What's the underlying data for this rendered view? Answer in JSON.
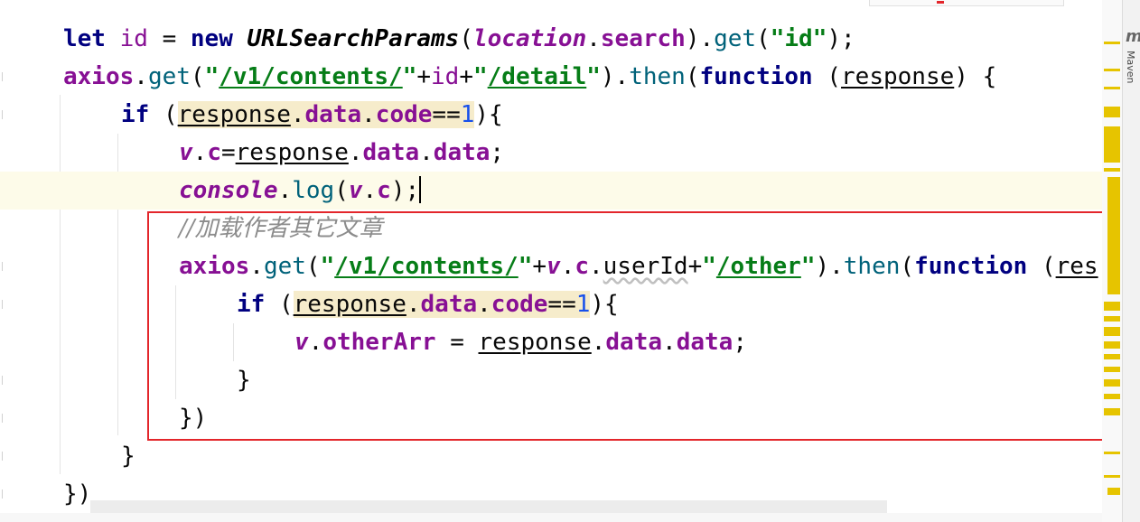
{
  "editor": {
    "lines": [
      {
        "id": 1,
        "tokens": [
          {
            "t": "let",
            "c": "kw"
          },
          {
            "t": " "
          },
          {
            "t": "id",
            "c": "v"
          },
          {
            "t": " = "
          },
          {
            "t": "new",
            "c": "kw"
          },
          {
            "t": " "
          },
          {
            "t": "URLSearchParams",
            "c": "cls"
          },
          {
            "t": "("
          },
          {
            "t": "location",
            "c": "vbi"
          },
          {
            "t": "."
          },
          {
            "t": "search",
            "c": "vb"
          },
          {
            "t": ")."
          },
          {
            "t": "get",
            "c": "fn"
          },
          {
            "t": "("
          },
          {
            "t": "\"id\"",
            "c": "str"
          },
          {
            "t": ");"
          }
        ]
      },
      {
        "id": 2,
        "tokens": [
          {
            "t": "axios",
            "c": "vb"
          },
          {
            "t": "."
          },
          {
            "t": "get",
            "c": "fn"
          },
          {
            "t": "("
          },
          {
            "t": "\"",
            "c": "str"
          },
          {
            "t": "/v1/contents/",
            "c": "str u"
          },
          {
            "t": "\"",
            "c": "str"
          },
          {
            "t": "+"
          },
          {
            "t": "id",
            "c": "v"
          },
          {
            "t": "+"
          },
          {
            "t": "\"",
            "c": "str"
          },
          {
            "t": "/detail",
            "c": "str u"
          },
          {
            "t": "\"",
            "c": "str"
          },
          {
            "t": ")."
          },
          {
            "t": "then",
            "c": "fn"
          },
          {
            "t": "("
          },
          {
            "t": "function",
            "c": "kw"
          },
          {
            "t": " ("
          },
          {
            "t": "response",
            "c": "u"
          },
          {
            "t": ") {"
          }
        ]
      },
      {
        "id": 3,
        "tokens": [
          {
            "t": "if",
            "c": "kw"
          },
          {
            "t": " ("
          },
          {
            "t": "response",
            "c": "u warn"
          },
          {
            "t": ".",
            "c": "warn"
          },
          {
            "t": "data",
            "c": "vb warn"
          },
          {
            "t": ".",
            "c": "warn"
          },
          {
            "t": "code",
            "c": "vb warn"
          },
          {
            "t": "==",
            "c": "warn"
          },
          {
            "t": "1",
            "c": "num warn"
          },
          {
            "t": "){"
          }
        ]
      },
      {
        "id": 4,
        "tokens": [
          {
            "t": "v",
            "c": "vbi"
          },
          {
            "t": "."
          },
          {
            "t": "c",
            "c": "vb"
          },
          {
            "t": "="
          },
          {
            "t": "response",
            "c": "u"
          },
          {
            "t": "."
          },
          {
            "t": "data",
            "c": "vb"
          },
          {
            "t": "."
          },
          {
            "t": "data",
            "c": "vb"
          },
          {
            "t": ";"
          }
        ]
      },
      {
        "id": 5,
        "current": true,
        "tokens": [
          {
            "t": "console",
            "c": "vbi"
          },
          {
            "t": "."
          },
          {
            "t": "log",
            "c": "fn"
          },
          {
            "t": "("
          },
          {
            "t": "v",
            "c": "vbi"
          },
          {
            "t": "."
          },
          {
            "t": "c",
            "c": "vb"
          },
          {
            "t": ");"
          }
        ]
      },
      {
        "id": 6,
        "tokens": [
          {
            "t": "//加载作者其它文章",
            "c": "cmt"
          }
        ]
      },
      {
        "id": 7,
        "tokens": [
          {
            "t": "axios",
            "c": "vb"
          },
          {
            "t": "."
          },
          {
            "t": "get",
            "c": "fn"
          },
          {
            "t": "("
          },
          {
            "t": "\"",
            "c": "str"
          },
          {
            "t": "/v1/contents/",
            "c": "str u"
          },
          {
            "t": "\"",
            "c": "str"
          },
          {
            "t": "+"
          },
          {
            "t": "v",
            "c": "vbi"
          },
          {
            "t": "."
          },
          {
            "t": "c",
            "c": "vb"
          },
          {
            "t": "."
          },
          {
            "t": "userId",
            "c": "wavy"
          },
          {
            "t": "+"
          },
          {
            "t": "\"",
            "c": "str"
          },
          {
            "t": "/other",
            "c": "str u"
          },
          {
            "t": "\"",
            "c": "str"
          },
          {
            "t": ")."
          },
          {
            "t": "then",
            "c": "fn"
          },
          {
            "t": "("
          },
          {
            "t": "function",
            "c": "kw"
          },
          {
            "t": " ("
          },
          {
            "t": "res",
            "c": "u"
          }
        ]
      },
      {
        "id": 8,
        "tokens": [
          {
            "t": "if",
            "c": "kw"
          },
          {
            "t": " ("
          },
          {
            "t": "response",
            "c": "u warn"
          },
          {
            "t": ".",
            "c": "warn"
          },
          {
            "t": "data",
            "c": "vb warn"
          },
          {
            "t": ".",
            "c": "warn"
          },
          {
            "t": "code",
            "c": "vb warn"
          },
          {
            "t": "==",
            "c": "warn"
          },
          {
            "t": "1",
            "c": "num warn"
          },
          {
            "t": "){"
          }
        ]
      },
      {
        "id": 9,
        "tokens": [
          {
            "t": "v",
            "c": "vbi"
          },
          {
            "t": "."
          },
          {
            "t": "otherArr",
            "c": "vb"
          },
          {
            "t": " = "
          },
          {
            "t": "response",
            "c": "u"
          },
          {
            "t": "."
          },
          {
            "t": "data",
            "c": "vb"
          },
          {
            "t": "."
          },
          {
            "t": "data",
            "c": "vb"
          },
          {
            "t": ";"
          }
        ]
      },
      {
        "id": 10,
        "tokens": [
          {
            "t": "}"
          }
        ]
      },
      {
        "id": 11,
        "tokens": [
          {
            "t": "})"
          }
        ]
      },
      {
        "id": 12,
        "tokens": [
          {
            "t": "}"
          }
        ]
      },
      {
        "id": 13,
        "tokens": [
          {
            "t": "})"
          }
        ]
      }
    ]
  },
  "side_panel": {
    "letter": "m",
    "label": "Maven"
  },
  "colors": {
    "highlight_box": "#e3262b",
    "current_line": "#fdfbe9",
    "stripe_mark": "#e6c400"
  }
}
